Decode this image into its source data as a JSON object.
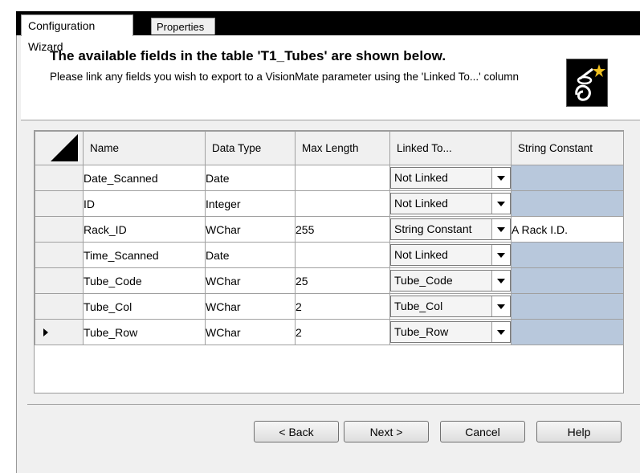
{
  "tabs": [
    {
      "label": "Configuration Wizard",
      "active": true
    },
    {
      "label": "Properties",
      "active": false
    }
  ],
  "header": {
    "title": "The available fields in the table 'T1_Tubes' are shown below.",
    "description": "Please link any fields you wish to export to a VisionMate parameter using the 'Linked To...' column",
    "icon": "wizard-wand-icon"
  },
  "grid": {
    "columns": [
      "Name",
      "Data Type",
      "Max Length",
      "Linked To...",
      "String Constant"
    ],
    "rows": [
      {
        "name": "Date_Scanned",
        "type": "Date",
        "max_length": "",
        "linked_to": "Not Linked",
        "string_constant": ""
      },
      {
        "name": "ID",
        "type": "Integer",
        "max_length": "",
        "linked_to": "Not Linked",
        "string_constant": ""
      },
      {
        "name": "Rack_ID",
        "type": "WChar",
        "max_length": "255",
        "linked_to": "String Constant",
        "string_constant": "A Rack I.D."
      },
      {
        "name": "Time_Scanned",
        "type": "Date",
        "max_length": "",
        "linked_to": "Not Linked",
        "string_constant": ""
      },
      {
        "name": "Tube_Code",
        "type": "WChar",
        "max_length": "25",
        "linked_to": "Tube_Code",
        "string_constant": ""
      },
      {
        "name": "Tube_Col",
        "type": "WChar",
        "max_length": "2",
        "linked_to": "Tube_Col",
        "string_constant": ""
      },
      {
        "name": "Tube_Row",
        "type": "WChar",
        "max_length": "2",
        "linked_to": "Tube_Row",
        "string_constant": ""
      }
    ],
    "current_row_index": 6,
    "disabled_cell_color": "#b8c8dc"
  },
  "buttons": {
    "back": "< Back",
    "next": "Next >",
    "cancel": "Cancel",
    "help": "Help"
  }
}
